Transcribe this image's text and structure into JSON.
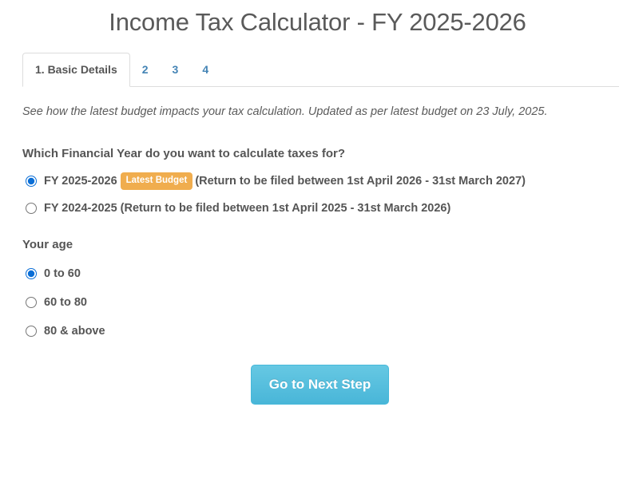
{
  "header": {
    "title": "Income Tax Calculator - FY 2025-2026"
  },
  "tabs": [
    {
      "label": "1. Basic Details",
      "active": true
    },
    {
      "label": "2",
      "active": false
    },
    {
      "label": "3",
      "active": false
    },
    {
      "label": "4",
      "active": false
    }
  ],
  "main": {
    "lead": "See how the latest budget impacts your tax calculation. Updated as per latest budget on 23 July, 2025.",
    "fy_question": "Which Financial Year do you want to calculate taxes for?",
    "fy_options": [
      {
        "label": "FY 2025-2026",
        "badge": "Latest Budget",
        "note": "(Return to be filed between 1st April 2026 - 31st March 2027)",
        "selected": true
      },
      {
        "label": "FY 2024-2025 (Return to be filed between 1st April 2025 - 31st March 2026)",
        "badge": "",
        "note": "",
        "selected": false
      }
    ],
    "age_question": "Your age",
    "age_options": [
      {
        "label": "0 to 60",
        "selected": true
      },
      {
        "label": "60 to 80",
        "selected": false
      },
      {
        "label": "80 & above",
        "selected": false
      }
    ],
    "next_button": "Go to Next Step"
  },
  "colors": {
    "badge_orange": "#f0ad4e",
    "button_blue": "#5bc0de",
    "tab_link_blue": "#4484b5",
    "text_gray": "#555555"
  }
}
